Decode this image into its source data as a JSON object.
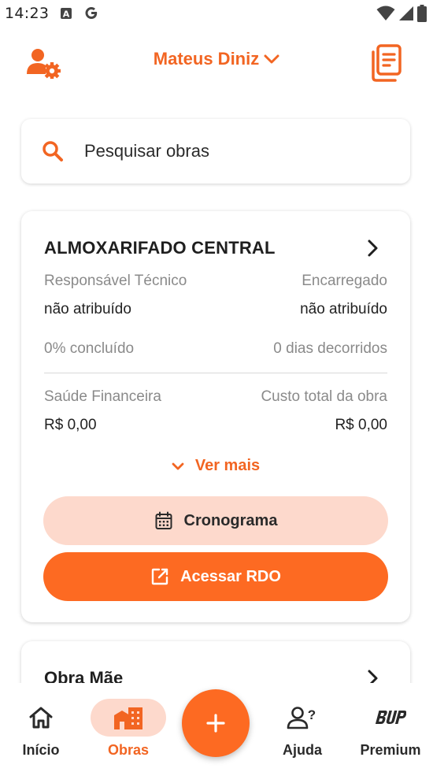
{
  "status_bar": {
    "time": "14:23",
    "icons": [
      "notification-a-icon",
      "google-icon",
      "wifi-icon",
      "signal-icon",
      "battery-icon"
    ]
  },
  "header": {
    "user_name": "Mateus Diniz",
    "left_icon": "user-settings-icon",
    "right_icon": "document-icon"
  },
  "search": {
    "placeholder": "Pesquisar obras"
  },
  "project_card": {
    "title": "ALMOXARIFADO CENTRAL",
    "responsavel_label": "Responsável Técnico",
    "responsavel_value": "não atribuído",
    "encarregado_label": "Encarregado",
    "encarregado_value": "não atribuído",
    "progress": "0% concluído",
    "days": "0 dias decorridos",
    "saude_label": "Saúde Financeira",
    "saude_value": "R$ 0,00",
    "custo_label": "Custo total da obra",
    "custo_value": "R$ 0,00",
    "ver_mais": "Ver mais",
    "cronograma_label": "Cronograma",
    "acessar_label": "Acessar RDO"
  },
  "second_card": {
    "title": "Obra Mãe"
  },
  "bottom_nav": {
    "items": [
      {
        "label": "Início",
        "icon": "home-icon",
        "active": false
      },
      {
        "label": "Obras",
        "icon": "buildings-icon",
        "active": true
      },
      {
        "label": "Ajuda",
        "icon": "help-person-icon",
        "active": false
      },
      {
        "label": "Premium",
        "icon": "bup-logo-icon",
        "active": false
      }
    ],
    "fab_icon": "plus-icon"
  },
  "colors": {
    "accent": "#f26522",
    "primary_button": "#fd6a22",
    "light_button": "#fdd9cc"
  }
}
